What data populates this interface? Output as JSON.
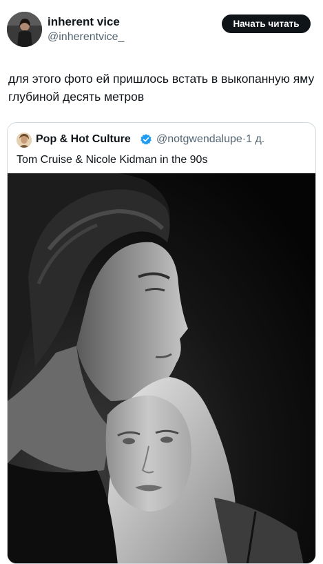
{
  "author": {
    "display_name": "inherent vice",
    "handle": "@inherentvice_",
    "avatar_icon": "profile-photo"
  },
  "subscribe_button": {
    "label": "Начать читать",
    "background": "#0f1419"
  },
  "post": {
    "text": "для этого фото ей пришлось встать в выкопанную яму глубиной десять метров"
  },
  "quoted_post": {
    "display_name": "Pop & Hot Culture",
    "verified_icon": "verified-badge-icon",
    "handle": "@notgwendalupe",
    "separator": "·",
    "time": "1 д.",
    "text": "Tom Cruise & Nicole Kidman in the 90s",
    "media": "black-and-white-photo"
  },
  "colors": {
    "text_primary": "#0f1419",
    "text_secondary": "#536471",
    "border": "#cfd9de",
    "verified": "#1d9bf0"
  }
}
